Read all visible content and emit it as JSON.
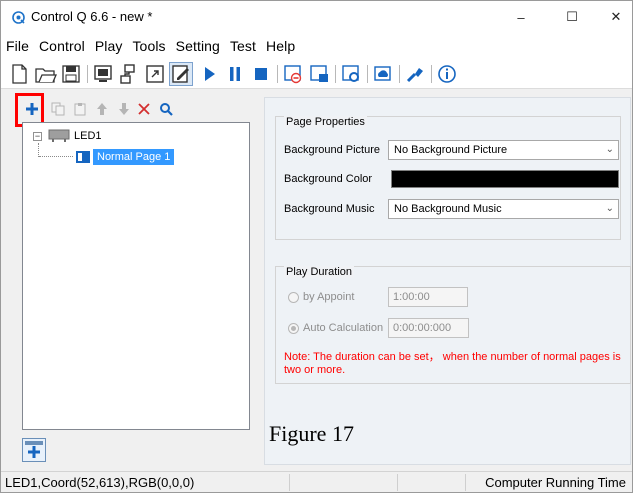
{
  "window": {
    "title": "Control Q 6.6 - new *",
    "minimize": "–",
    "maximize": "☐",
    "close": "✕"
  },
  "menu": [
    "File",
    "Control",
    "Play",
    "Tools",
    "Setting",
    "Test",
    "Help"
  ],
  "toolbar": {
    "icons": [
      "new-file-icon",
      "open-folder-icon",
      "save-icon",
      "screen-icon",
      "network-icon",
      "fullscreen-icon",
      "edit-icon",
      "play-icon",
      "pause-icon",
      "stop-icon",
      "delete-program-icon",
      "sync-program-icon",
      "settings-program-icon",
      "cloud-icon",
      "broom-icon",
      "info-icon"
    ]
  },
  "page_tools": {
    "icons": [
      "add-icon",
      "copy-icon",
      "paste-icon",
      "move-up-icon",
      "move-down-icon",
      "delete-icon",
      "search-icon"
    ]
  },
  "tree": {
    "toggle": "−",
    "led_label": "LED1",
    "page_label": "Normal Page 1"
  },
  "page_properties": {
    "title": "Page Properties",
    "bg_picture_label": "Background Picture",
    "bg_picture_value": "No Background Picture",
    "bg_color_label": "Background Color",
    "bg_color_value": "#000000",
    "bg_music_label": "Background Music",
    "bg_music_value": "No Background Music"
  },
  "play_duration": {
    "title": "Play Duration",
    "appoint_label": "by Appoint",
    "appoint_value": "1:00:00",
    "auto_label": "Auto Calculation",
    "auto_value": "0:00:00:000",
    "note": "Note: The duration can be set， when the number of normal pages is two or more."
  },
  "caption": "Figure 17",
  "status": {
    "left": "LED1,Coord(52,613),RGB(0,0,0)",
    "right": "Computer Running Time"
  },
  "colors": {
    "accent": "#3399ff",
    "highlight_box": "#ff0000",
    "play_blue": "#1565c0",
    "note_red": "#ff0000"
  }
}
